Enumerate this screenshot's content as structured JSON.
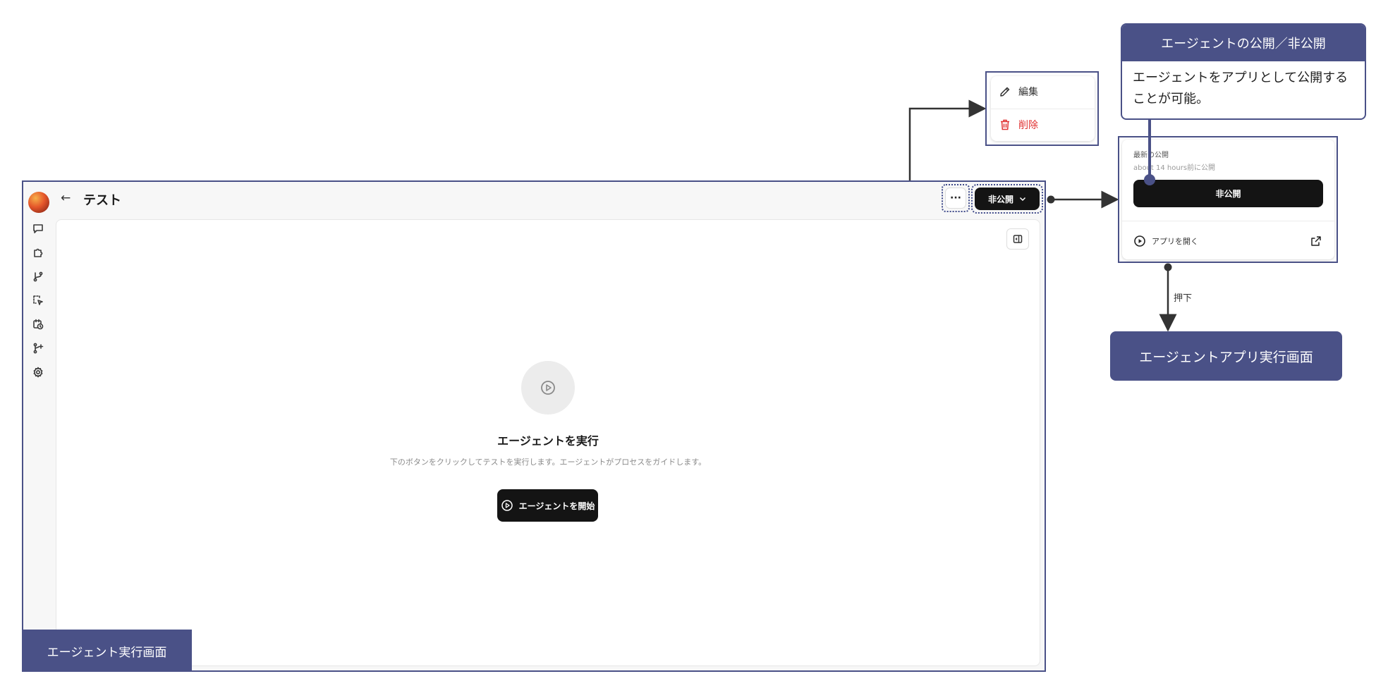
{
  "app": {
    "title": "テスト",
    "back_icon": "arrow-left-icon",
    "more_label": "···",
    "publish_button_label": "非公開",
    "sidebar_icons": [
      "chat-icon",
      "puzzle-icon",
      "branch-icon",
      "select-icon",
      "schedule-icon",
      "branch-add-icon",
      "gear-icon"
    ]
  },
  "content": {
    "run_title": "エージェントを実行",
    "run_description": "下のボタンをクリックしてテストを実行します。エージェントがプロセスをガイドします。",
    "start_button_label": "エージェントを開始"
  },
  "menu": {
    "edit_label": "編集",
    "delete_label": "削除"
  },
  "popover": {
    "latest_label": "最新の公開",
    "published_time": "about 14 hours前に公開",
    "unpublish_button_label": "非公開",
    "open_app_label": "アプリを開く"
  },
  "callout": {
    "title": "エージェントの公開／非公開",
    "body": "エージェントをアプリとして公開することが可能。"
  },
  "labels": {
    "main_screen": "エージェント実行画面",
    "app_screen": "エージェントアプリ実行画面",
    "press": "押下"
  },
  "colors": {
    "accent": "#4a5187",
    "button_dark": "#141414",
    "delete_red": "#e03131"
  }
}
